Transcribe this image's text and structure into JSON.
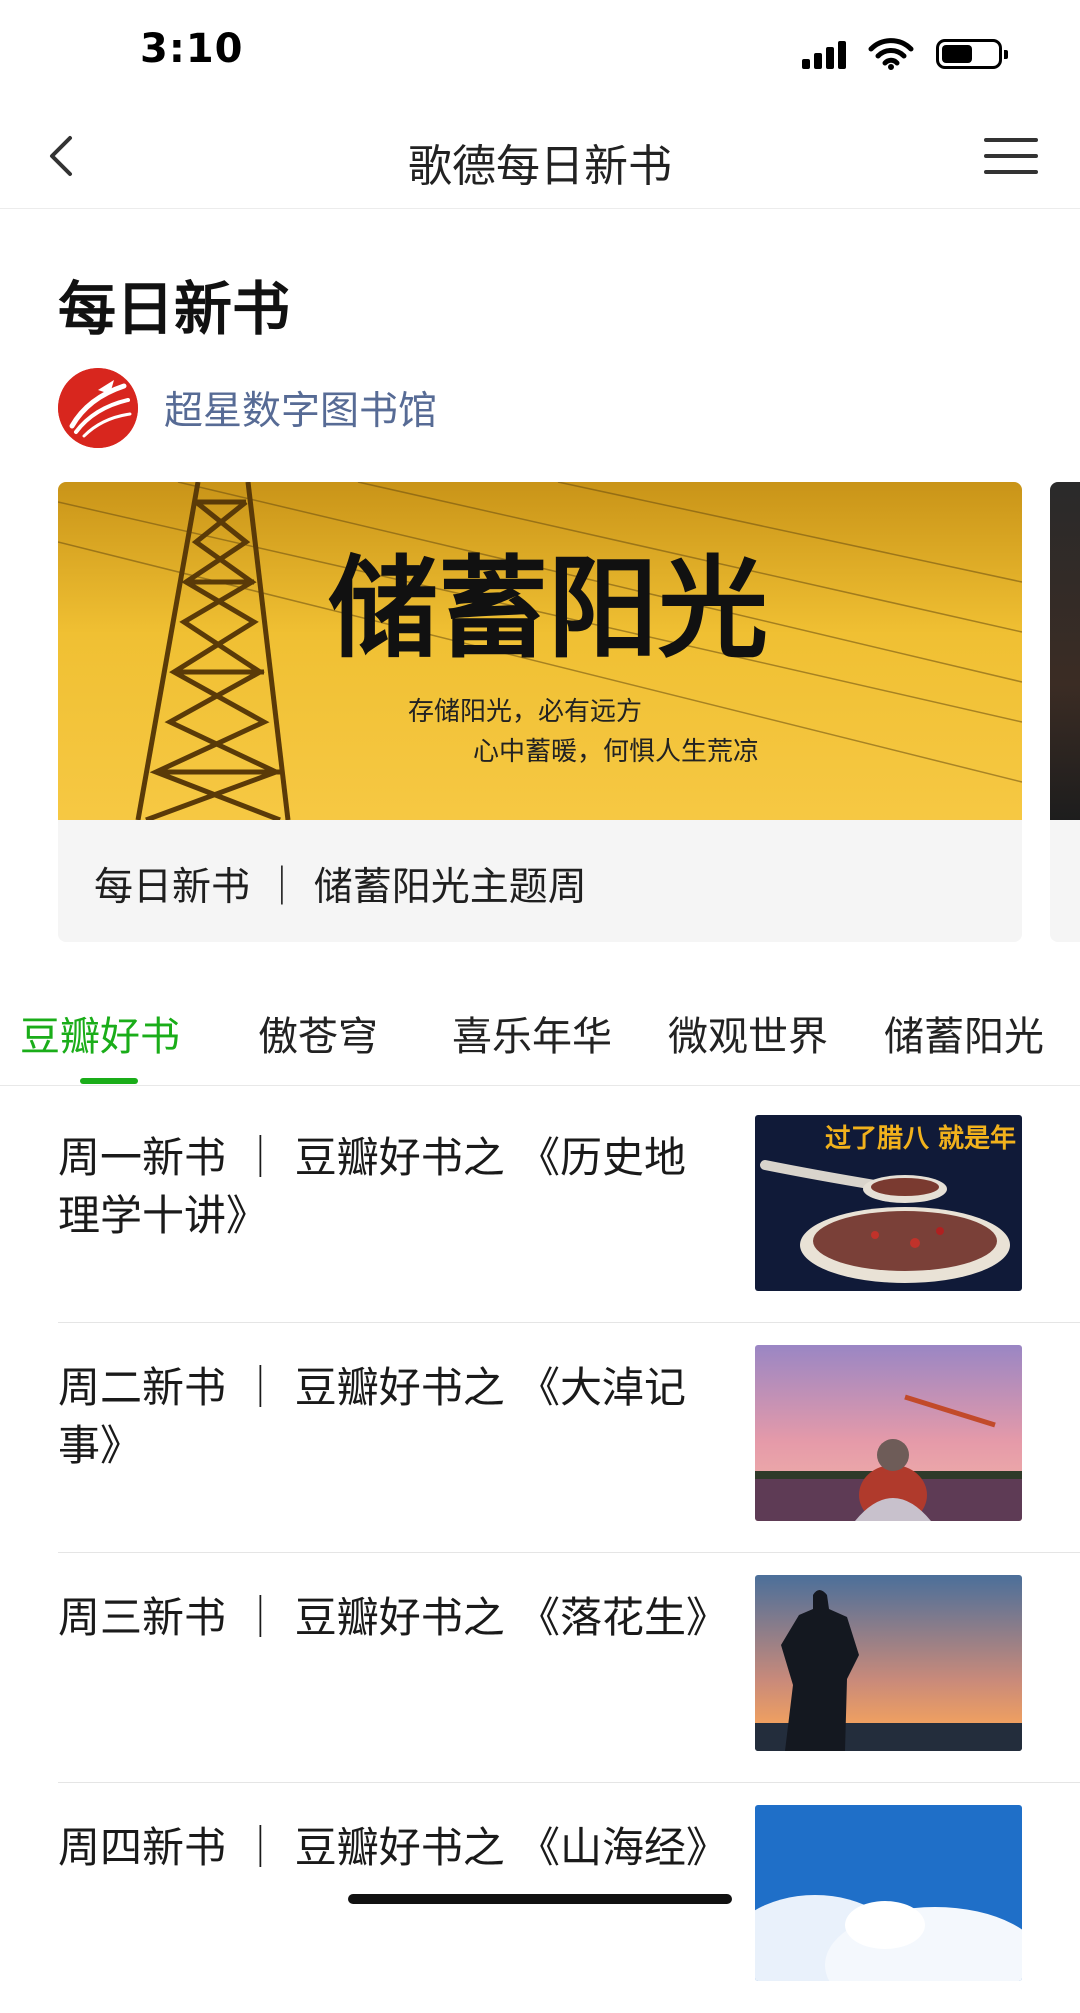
{
  "status_bar": {
    "time": "3:10"
  },
  "nav": {
    "title": "歌德每日新书"
  },
  "page": {
    "title": "每日新书",
    "account_name": "超星数字图书馆"
  },
  "banner": {
    "headline": "储蓄阳光",
    "line1": "存储阳光，必有远方",
    "line2": "心中蓄暖，何惧人生荒凉",
    "caption": "每日新书 ｜ 储蓄阳光主题周"
  },
  "tabs": [
    {
      "label": "豆瓣好书",
      "active": true
    },
    {
      "label": "傲苍穹",
      "active": false
    },
    {
      "label": "喜乐年华",
      "active": false
    },
    {
      "label": "微观世界",
      "active": false
    },
    {
      "label": "储蓄阳光",
      "active": false
    }
  ],
  "articles": [
    {
      "title": "周一新书 ｜ 豆瓣好书之 《历史地理学十讲》",
      "thumb_text": "过了腊八 就是年"
    },
    {
      "title": "周二新书 ｜ 豆瓣好书之 《大淖记事》"
    },
    {
      "title": "周三新书 ｜ 豆瓣好书之 《落花生》"
    },
    {
      "title": "周四新书 ｜ 豆瓣好书之 《山海经》"
    }
  ],
  "colors": {
    "accent": "#1aad19",
    "account_link": "#576b95",
    "logo_red": "#d8261e"
  },
  "icons": [
    "chevron-left-icon",
    "menu-icon",
    "cellular-signal-icon",
    "wifi-icon",
    "battery-icon"
  ],
  "battery_level": 0.55
}
